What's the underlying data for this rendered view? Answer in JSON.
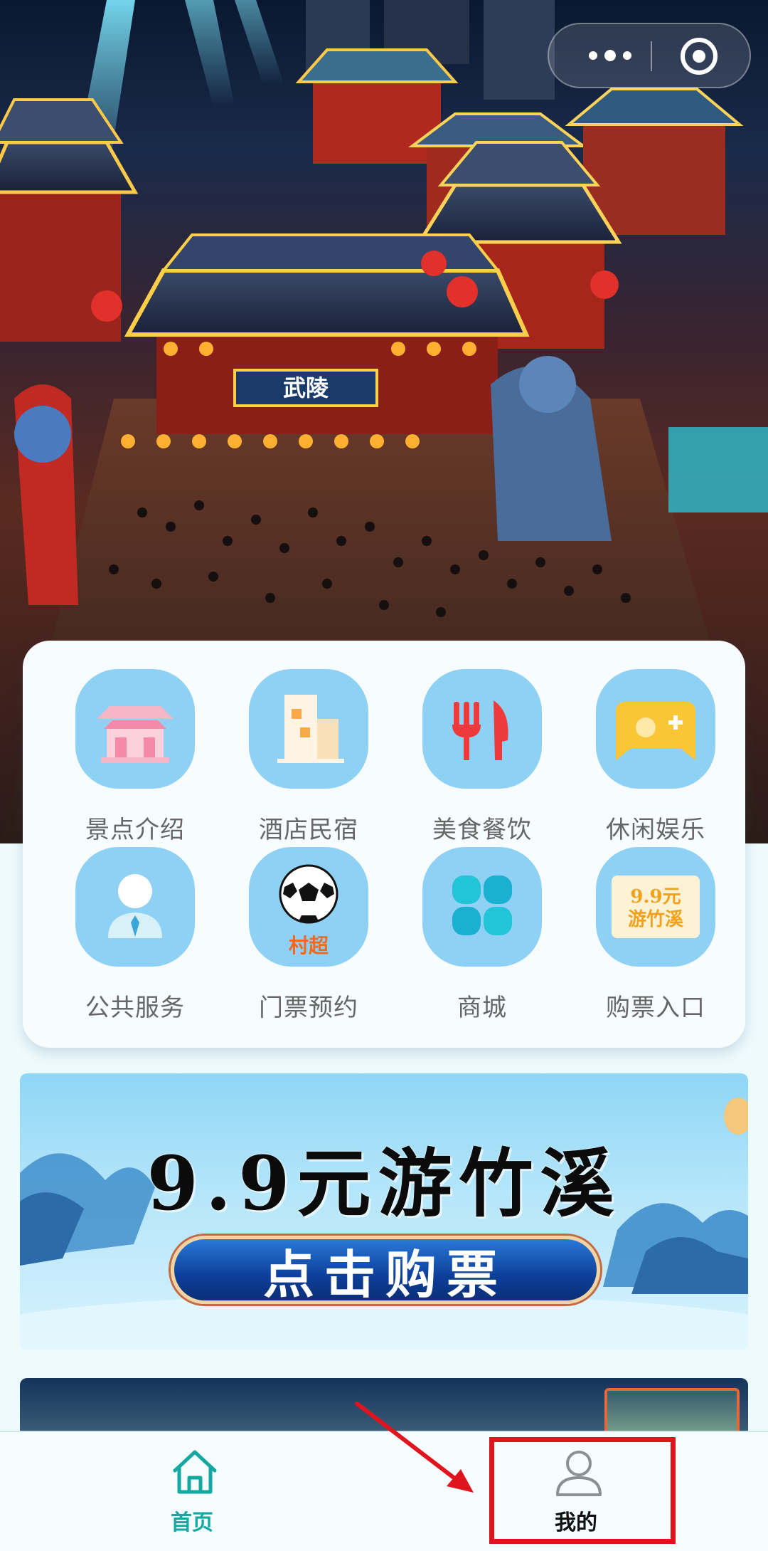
{
  "colors": {
    "accent": "#14a8a0",
    "icon_bg": "#8fd0f5",
    "annotation": "#e0141c"
  },
  "hero": {
    "gate_sign": "武陵",
    "capsule": {
      "more_icon": "more-dots-icon",
      "close_icon": "target-circle-icon"
    }
  },
  "grid": {
    "items": [
      {
        "label": "景点介绍",
        "icon": "pavilion-icon"
      },
      {
        "label": "酒店民宿",
        "icon": "building-icon"
      },
      {
        "label": "美食餐饮",
        "icon": "fork-knife-icon"
      },
      {
        "label": "休闲娱乐",
        "icon": "gamepad-icon"
      },
      {
        "label": "公共服务",
        "icon": "person-service-icon"
      },
      {
        "label": "门票预约",
        "icon": "soccer-ball-icon",
        "badge": "村超"
      },
      {
        "label": "商城",
        "icon": "clover-icon"
      },
      {
        "label": "购票入口",
        "icon": "ticket-icon",
        "badge_line1": "9.9元",
        "badge_line2": "游竹溪"
      }
    ]
  },
  "promo": {
    "title": "9.9元游竹溪",
    "button": "点击购票"
  },
  "tabbar": {
    "home": {
      "label": "首页",
      "icon": "home-icon"
    },
    "mine": {
      "label": "我的",
      "icon": "user-icon"
    }
  }
}
